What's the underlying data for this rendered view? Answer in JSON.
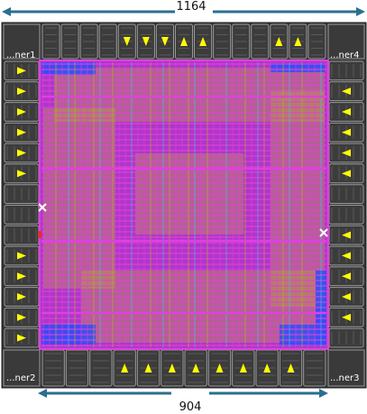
{
  "layout_view": {
    "dimensions": {
      "top_width": "1164",
      "bottom_width": "904"
    },
    "corners": {
      "top_left": "...ner1",
      "top_right": "...ner4",
      "bottom_right": "...ner3",
      "bottom_left": "...ner2"
    },
    "colors": {
      "background": "#333333",
      "pad": "#3c3c3c",
      "pad_outline": "#9a9a9a",
      "arrow": "#ffff00",
      "core_base": "#b036c8",
      "metal_magenta": "#e040e0",
      "metal_yellow": "#b7b420",
      "metal_blue": "#2050ff",
      "metal_cyan": "#40c8e0",
      "dimension_line": "#2a6f8f",
      "marker": "#ffffff"
    },
    "pad_directions": {
      "top": [
        "none",
        "none",
        "none",
        "none",
        "down",
        "down",
        "down",
        "up",
        "up",
        "none",
        "none",
        "none",
        "up",
        "up",
        "none"
      ],
      "bottom": [
        "none",
        "none",
        "none",
        "up",
        "up",
        "up",
        "up",
        "up",
        "up",
        "up",
        "up",
        "none"
      ],
      "left": [
        "right",
        "right",
        "right",
        "right",
        "right",
        "right",
        "none",
        "none",
        "none",
        "right",
        "right",
        "right",
        "right",
        "right"
      ],
      "right": [
        "none",
        "left",
        "left",
        "left",
        "left",
        "left",
        "none",
        "none",
        "left",
        "left",
        "left",
        "left",
        "left",
        "none"
      ]
    }
  }
}
